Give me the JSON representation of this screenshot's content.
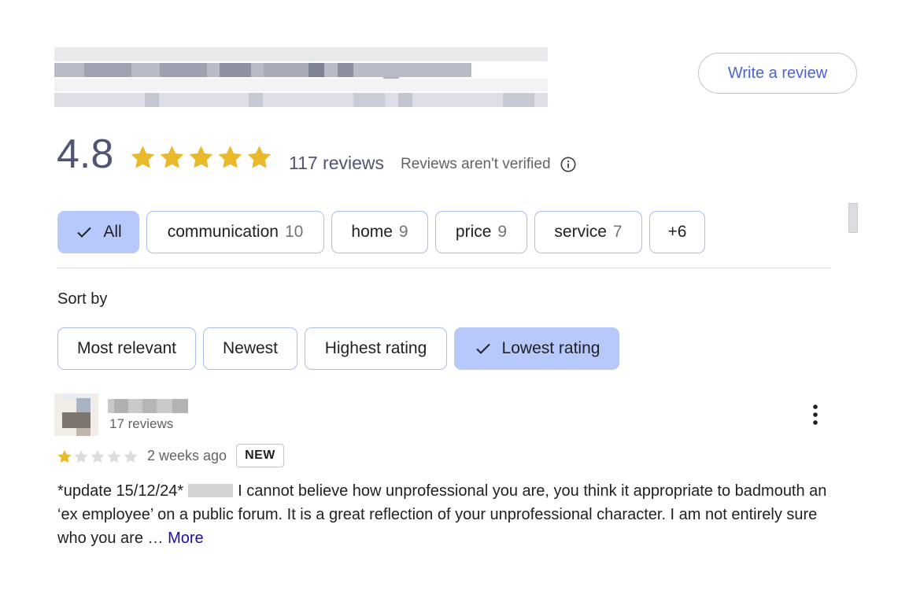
{
  "header": {
    "title_redacted": true,
    "write_review_label": "Write a review"
  },
  "summary": {
    "rating": "4.8",
    "rating_value": 4.8,
    "stars_filled": 5,
    "review_count": "117 reviews",
    "not_verified": "Reviews aren't verified"
  },
  "topics": [
    {
      "label": "All",
      "count": "",
      "selected": true
    },
    {
      "label": "communication",
      "count": "10",
      "selected": false
    },
    {
      "label": "home",
      "count": "9",
      "selected": false
    },
    {
      "label": "price",
      "count": "9",
      "selected": false
    },
    {
      "label": "service",
      "count": "7",
      "selected": false
    },
    {
      "label": "+6",
      "count": "",
      "selected": false
    }
  ],
  "sort": {
    "label": "Sort by",
    "options": [
      {
        "label": "Most relevant",
        "selected": false
      },
      {
        "label": "Newest",
        "selected": false
      },
      {
        "label": "Highest rating",
        "selected": false
      },
      {
        "label": "Lowest rating",
        "selected": true
      }
    ]
  },
  "review": {
    "reviewer_count": "17 reviews",
    "rating": 1,
    "time": "2 weeks ago",
    "badge": "NEW",
    "text_before": "*update 15/12/24*",
    "text_after": "I cannot believe how unprofessional you are, you think it appropriate to badmouth an ‘ex employee’ on a public forum. It is a great reflection of your unprofessional character. I am not entirely sure who you are …",
    "more_label": "More"
  },
  "colors": {
    "star": "#e9b92b",
    "star_empty": "#dadce0",
    "chip_selected": "#b6c9fa",
    "link": "#4b63d8"
  },
  "icons": {
    "info": "info-icon",
    "check": "check-icon",
    "menu": "more-vert-icon",
    "star": "star-icon"
  }
}
